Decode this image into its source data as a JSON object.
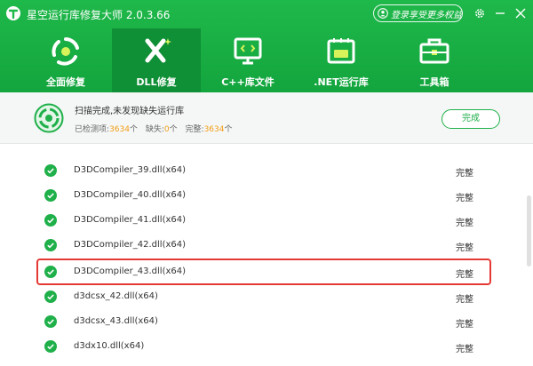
{
  "app": {
    "title": "星空运行库修复大师 2.0.3.66",
    "login_label": "登录享受更多权益"
  },
  "tabs": [
    {
      "label": "全面修复",
      "icon": "repair-cycle-icon"
    },
    {
      "label": "DLL修复",
      "icon": "dll-tools-icon",
      "active": true
    },
    {
      "label": "C++库文件",
      "icon": "code-monitor-icon"
    },
    {
      "label": ".NET运行库",
      "icon": "net-box-icon"
    },
    {
      "label": "工具箱",
      "icon": "toolbox-icon"
    }
  ],
  "status": {
    "message": "扫描完成,未发现缺失运行库",
    "checked_label": "已检测项:",
    "checked_count": "3634",
    "checked_unit": "个",
    "missing_label": "缺失:",
    "missing_count": "0",
    "missing_unit": "个",
    "complete_label": "完整:",
    "complete_count": "3634",
    "complete_unit": "个",
    "done_button": "完成"
  },
  "rows": [
    {
      "name": "D3DCompiler_39.dll(x64)",
      "status": "完整"
    },
    {
      "name": "D3DCompiler_40.dll(x64)",
      "status": "完整"
    },
    {
      "name": "D3DCompiler_41.dll(x64)",
      "status": "完整"
    },
    {
      "name": "D3DCompiler_42.dll(x64)",
      "status": "完整"
    },
    {
      "name": "D3DCompiler_43.dll(x64)",
      "status": "完整",
      "highlighted": true
    },
    {
      "name": "d3dcsx_42.dll(x64)",
      "status": "完整"
    },
    {
      "name": "d3dcsx_43.dll(x64)",
      "status": "完整"
    },
    {
      "name": "d3dx10.dll(x64)",
      "status": "完整"
    }
  ],
  "colors": {
    "brand_green": "#1fb84a",
    "active_tab": "#0f8f36",
    "count_orange": "#f39c12",
    "highlight_red": "#e53935"
  }
}
